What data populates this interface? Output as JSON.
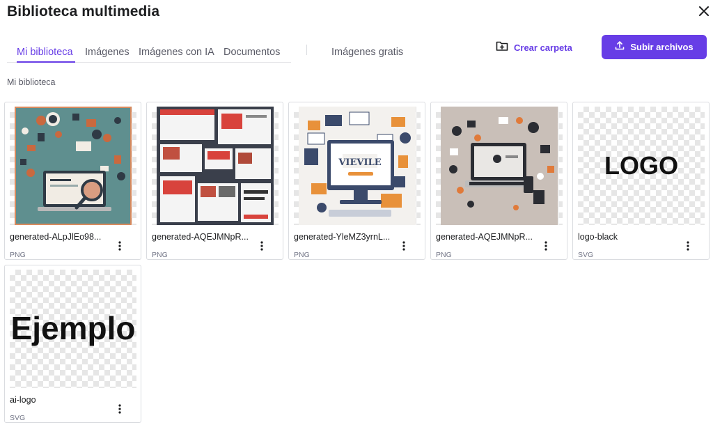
{
  "header": {
    "title": "Biblioteca multimedia",
    "close_icon": "close-icon"
  },
  "tabs": [
    {
      "label": "Mi biblioteca",
      "active": true
    },
    {
      "label": "Imágenes",
      "active": false
    },
    {
      "label": "Imágenes con IA",
      "active": false
    },
    {
      "label": "Documentos",
      "active": false
    }
  ],
  "free_images_tab": {
    "label": "Imágenes gratis"
  },
  "actions": {
    "create_folder": {
      "label": "Crear carpeta",
      "icon": "folder-plus-icon"
    },
    "upload": {
      "label": "Subir archivos",
      "icon": "upload-icon"
    }
  },
  "section": {
    "label": "Mi biblioteca"
  },
  "colors": {
    "accent": "#673de6",
    "text": "#1d1e20",
    "muted": "#727586"
  },
  "files": [
    {
      "name": "generated-ALpJlEo98...",
      "type": "PNG",
      "thumbnail": "illustration-laptop-magnifier"
    },
    {
      "name": "generated-AQEJMNpR...",
      "type": "PNG",
      "thumbnail": "illustration-website-collage"
    },
    {
      "name": "generated-YleMZ3yrnL...",
      "type": "PNG",
      "thumbnail": "illustration-monitor-desk"
    },
    {
      "name": "generated-AQEJMNpR...",
      "type": "PNG",
      "thumbnail": "illustration-laptop-gadgets"
    },
    {
      "name": "logo-black",
      "type": "SVG",
      "thumbnail": "text-logo",
      "thumb_text": "LOGO"
    },
    {
      "name": "ai-logo",
      "type": "SVG",
      "thumbnail": "text-logo",
      "thumb_text": "Ejemplo"
    }
  ]
}
